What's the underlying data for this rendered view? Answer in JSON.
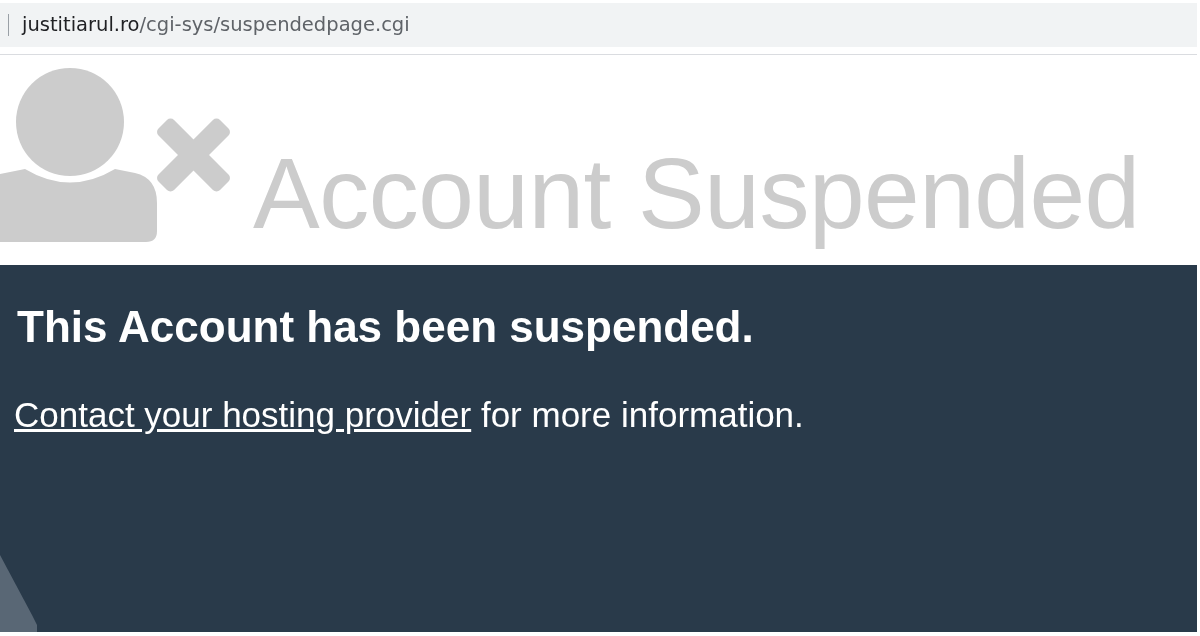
{
  "address_bar": {
    "host": "justitiarul.ro",
    "path": "/cgi-sys/suspendedpage.cgi"
  },
  "banner": {
    "title": "Account Suspended"
  },
  "panel": {
    "heading": "This Account has been suspended.",
    "link": "Contact your hosting provider",
    "text": "for more information."
  }
}
